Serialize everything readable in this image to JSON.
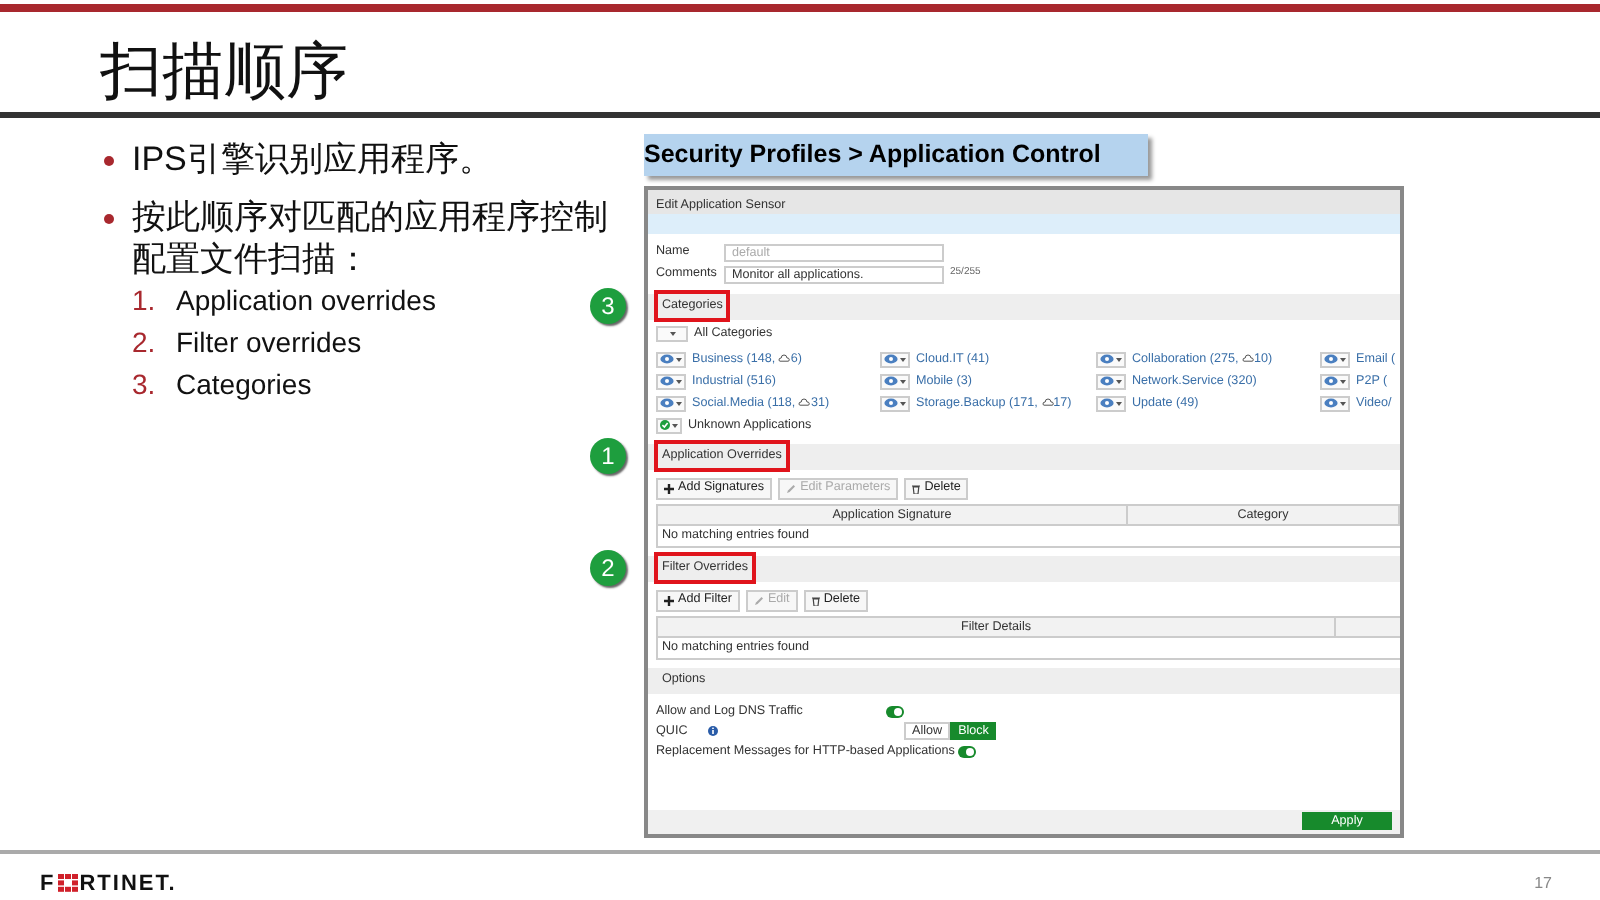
{
  "slide": {
    "title": "扫描顺序",
    "bullets": [
      {
        "text": "IPS引擎识别应用程序。"
      },
      {
        "text": "按此顺序对匹配的应用程序控制配置文件扫描：",
        "items": [
          {
            "number": "1.",
            "text": "Application overrides"
          },
          {
            "number": "2.",
            "text": "Filter overrides"
          },
          {
            "number": "3.",
            "text": "Categories"
          }
        ]
      }
    ],
    "caption": "Security Profiles > Application Control",
    "footer": {
      "logo_start": "F",
      "logo_end": "RTINET.",
      "page": "17"
    }
  },
  "app": {
    "title": "Edit Application Sensor",
    "fields": [
      {
        "label": "Name",
        "value": "default",
        "disabled": true
      },
      {
        "label": "Comments",
        "value": "Monitor all applications.",
        "disabled": false,
        "counter": "25/255"
      }
    ],
    "categories": {
      "title": "Categories",
      "marker": "3",
      "highlighted": true,
      "all_label": "All Categories",
      "items": [
        {
          "label": "Business (148,",
          "cloud": "6)",
          "kind": "monitor"
        },
        {
          "label": "Cloud.IT (41)",
          "kind": "monitor"
        },
        {
          "label": "Collaboration (275,",
          "cloud": "10)",
          "kind": "monitor"
        },
        {
          "label": "Email (",
          "kind": "monitor"
        },
        {
          "label": "Industrial (516)",
          "kind": "monitor"
        },
        {
          "label": "Mobile (3)",
          "kind": "monitor"
        },
        {
          "label": "Network.Service (320)",
          "kind": "monitor"
        },
        {
          "label": "P2P (",
          "kind": "monitor"
        },
        {
          "label": "Social.Media (118,",
          "cloud": "31)",
          "kind": "monitor"
        },
        {
          "label": "Storage.Backup (171,",
          "cloud": "17)",
          "kind": "monitor"
        },
        {
          "label": "Update (49)",
          "kind": "monitor"
        },
        {
          "label": "Video/",
          "kind": "monitor"
        },
        {
          "label": "Unknown Applications",
          "kind": "allow"
        }
      ]
    },
    "tables": [
      {
        "title": "Application Overrides",
        "marker": "1",
        "highlighted": true,
        "buttons": [
          {
            "label": "Add Signatures",
            "kind": "add",
            "disabled": false
          },
          {
            "label": "Edit Parameters",
            "kind": "edit",
            "disabled": true
          },
          {
            "label": "Delete",
            "kind": "delete",
            "disabled": false
          }
        ],
        "columns": [
          "Application Signature",
          "Category"
        ],
        "empty": "No matching entries found"
      },
      {
        "title": "Filter Overrides",
        "marker": "2",
        "highlighted": true,
        "buttons": [
          {
            "label": "Add Filter",
            "kind": "add",
            "disabled": false
          },
          {
            "label": "Edit",
            "kind": "edit",
            "disabled": true
          },
          {
            "label": "Delete",
            "kind": "delete",
            "disabled": false
          }
        ],
        "columns": [
          "Filter Details"
        ],
        "empty": "No matching entries found"
      }
    ],
    "options": {
      "title": "Options",
      "highlighted": false,
      "rows": [
        {
          "kind": "toggle",
          "label": "Allow and Log DNS Traffic",
          "on": true
        },
        {
          "kind": "segmented",
          "label": "QUIC",
          "info": true,
          "options": [
            {
              "label": "Allow",
              "selected": false
            },
            {
              "label": "Block",
              "selected": true
            }
          ]
        },
        {
          "kind": "toggle",
          "label": "Replacement Messages for HTTP-based Applications",
          "on": true
        }
      ]
    },
    "apply": "Apply"
  }
}
